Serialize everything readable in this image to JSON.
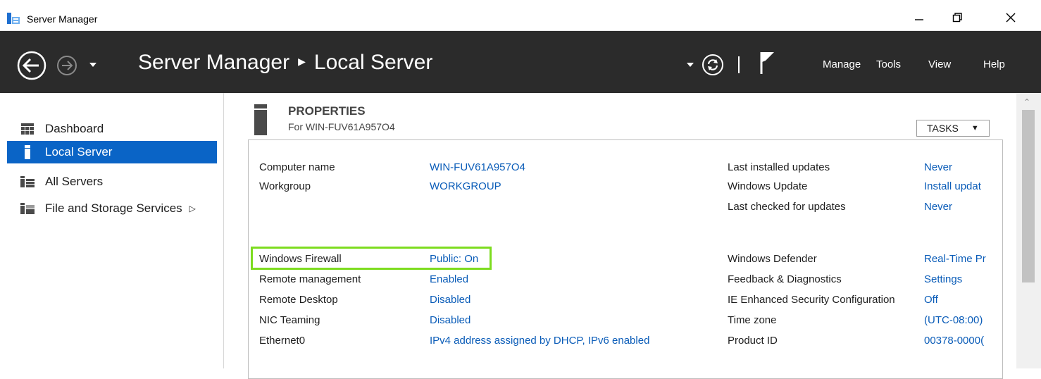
{
  "window": {
    "title": "Server Manager"
  },
  "header": {
    "breadcrumb_root": "Server Manager",
    "breadcrumb_current": "Local Server",
    "menu": [
      "Manage",
      "Tools",
      "View",
      "Help"
    ]
  },
  "sidebar": {
    "items": [
      {
        "label": "Dashboard",
        "icon": "dashboard-icon",
        "active": false
      },
      {
        "label": "Local Server",
        "icon": "server-icon",
        "active": true
      },
      {
        "label": "All Servers",
        "icon": "servers-icon",
        "active": false
      },
      {
        "label": "File and Storage Services",
        "icon": "storage-icon",
        "active": false,
        "has_submenu": true
      }
    ]
  },
  "properties": {
    "title": "PROPERTIES",
    "subtitle": "For WIN-FUV61A957O4",
    "tasks_label": "TASKS",
    "left": [
      {
        "label": "Computer name",
        "value": "WIN-FUV61A957O4"
      },
      {
        "label": "Workgroup",
        "value": "WORKGROUP"
      },
      {
        "label": "Windows Firewall",
        "value": "Public: On",
        "highlighted": true
      },
      {
        "label": "Remote management",
        "value": "Enabled"
      },
      {
        "label": "Remote Desktop",
        "value": "Disabled"
      },
      {
        "label": "NIC Teaming",
        "value": "Disabled"
      },
      {
        "label": "Ethernet0",
        "value": "IPv4 address assigned by DHCP, IPv6 enabled"
      }
    ],
    "right": [
      {
        "label": "Last installed updates",
        "value": "Never"
      },
      {
        "label": "Windows Update",
        "value": "Install updat"
      },
      {
        "label": "Last checked for updates",
        "value": "Never"
      },
      {
        "label": "Windows Defender",
        "value": "Real-Time Pr"
      },
      {
        "label": "Feedback & Diagnostics",
        "value": "Settings"
      },
      {
        "label": "IE Enhanced Security Configuration",
        "value": "Off"
      },
      {
        "label": "Time zone",
        "value": "(UTC-08:00)"
      },
      {
        "label": "Product ID",
        "value": "00378-0000("
      }
    ]
  },
  "colors": {
    "header_bg": "#2b2b2b",
    "active_item": "#0a64c6",
    "link": "#0a5cb8",
    "highlight": "#7ddc1f"
  }
}
